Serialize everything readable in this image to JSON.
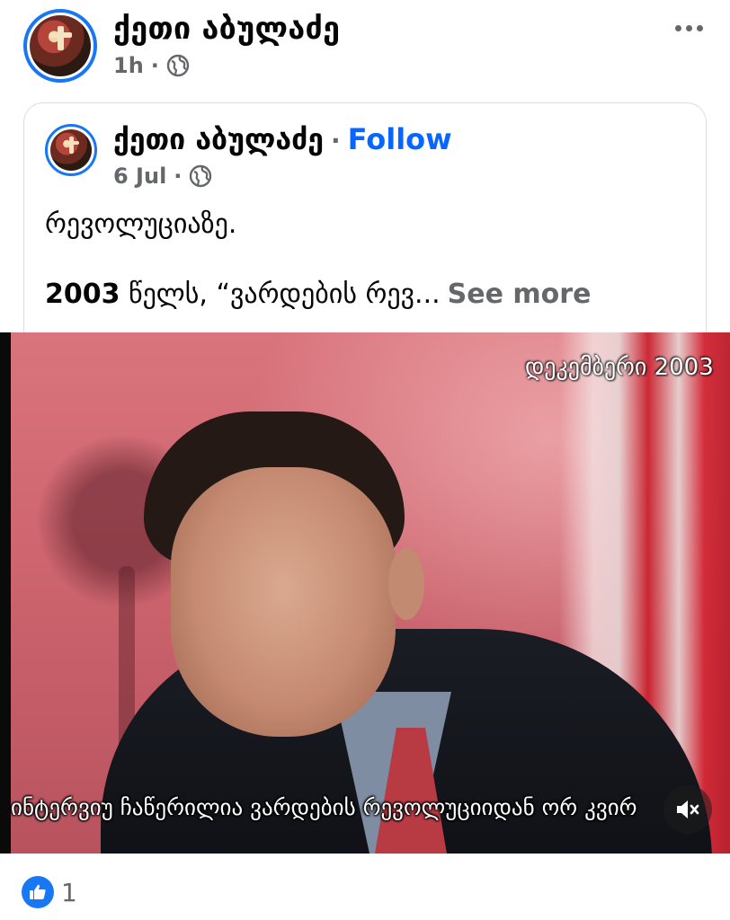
{
  "post": {
    "author": "ქეთი აბულაძე",
    "time": "1h",
    "separator": "·",
    "privacy_icon": "globe-icon",
    "menu_icon": "more-options-icon"
  },
  "shared_post": {
    "author": "ქეთი აბულაძე",
    "separator": "·",
    "follow_label": "Follow",
    "date": "6 Jul",
    "privacy_icon": "globe-icon",
    "text_line1": "რევოლუციაზე.",
    "text_line2_year": "2003",
    "text_line2_rest": " წელს, “ვარდების რევ...",
    "see_more": "See more"
  },
  "video": {
    "date_overlay": "დეკემბერი 2003",
    "subtitle": "ინტერვიუ ჩაწერილია ვარდების რევოლუციიდან ორ კვირ",
    "mute_icon": "muted-speaker-icon"
  },
  "reactions": {
    "icon": "like-icon",
    "count": "1"
  },
  "colors": {
    "accent": "#1877f2",
    "follow": "#0866ff",
    "secondary_text": "#65676b"
  }
}
